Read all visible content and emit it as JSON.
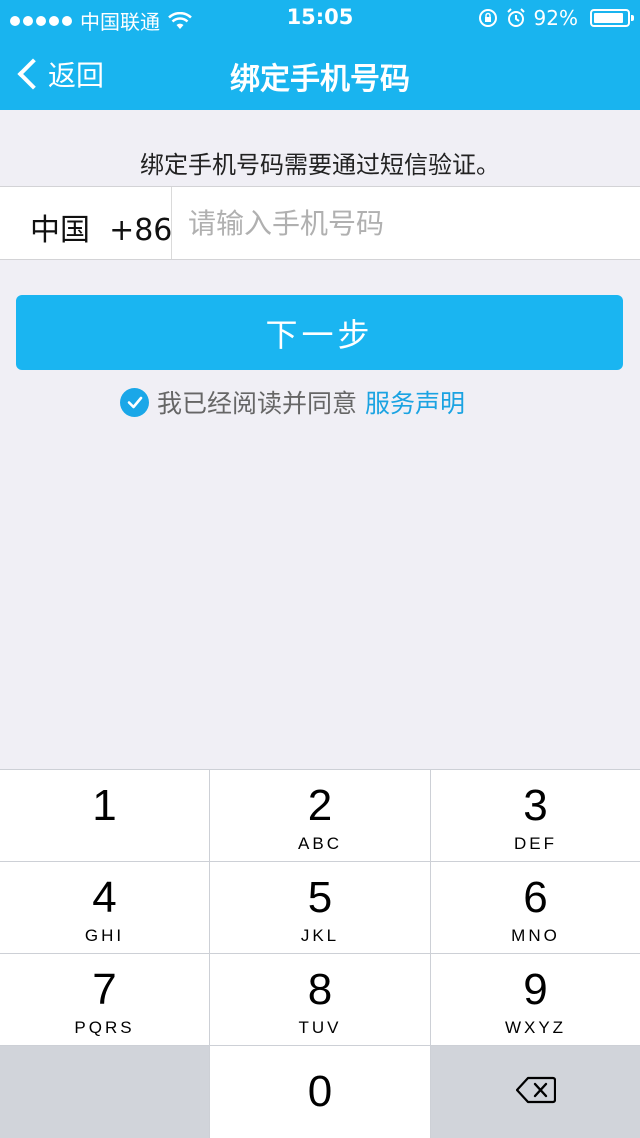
{
  "status_bar": {
    "carrier": "中国联通",
    "time": "15:05",
    "battery_percent": "92%",
    "battery_level": 0.92,
    "icons": [
      "signal-dots",
      "wifi-icon",
      "rotation-lock-icon",
      "alarm-icon",
      "battery-icon"
    ]
  },
  "nav": {
    "back_label": "返回",
    "title": "绑定手机号码"
  },
  "content": {
    "hint": "绑定手机号码需要通过短信验证。",
    "country_code": "中国  +86",
    "phone_placeholder": "请输入手机号码",
    "phone_value": "",
    "next_label": "下一步",
    "agree_text": "我已经阅读并同意",
    "agree_link": "服务声明",
    "agree_checked": true
  },
  "colors": {
    "accent": "#19b4ef",
    "link": "#1ba3e2",
    "background": "#f0eff5"
  },
  "keypad": {
    "keys": [
      {
        "num": "1",
        "letters": ""
      },
      {
        "num": "2",
        "letters": "ABC"
      },
      {
        "num": "3",
        "letters": "DEF"
      },
      {
        "num": "4",
        "letters": "GHI"
      },
      {
        "num": "5",
        "letters": "JKL"
      },
      {
        "num": "6",
        "letters": "MNO"
      },
      {
        "num": "7",
        "letters": "PQRS"
      },
      {
        "num": "8",
        "letters": "TUV"
      },
      {
        "num": "9",
        "letters": "WXYZ"
      },
      {
        "num": "0",
        "letters": ""
      }
    ],
    "delete_icon": "backspace-icon"
  }
}
